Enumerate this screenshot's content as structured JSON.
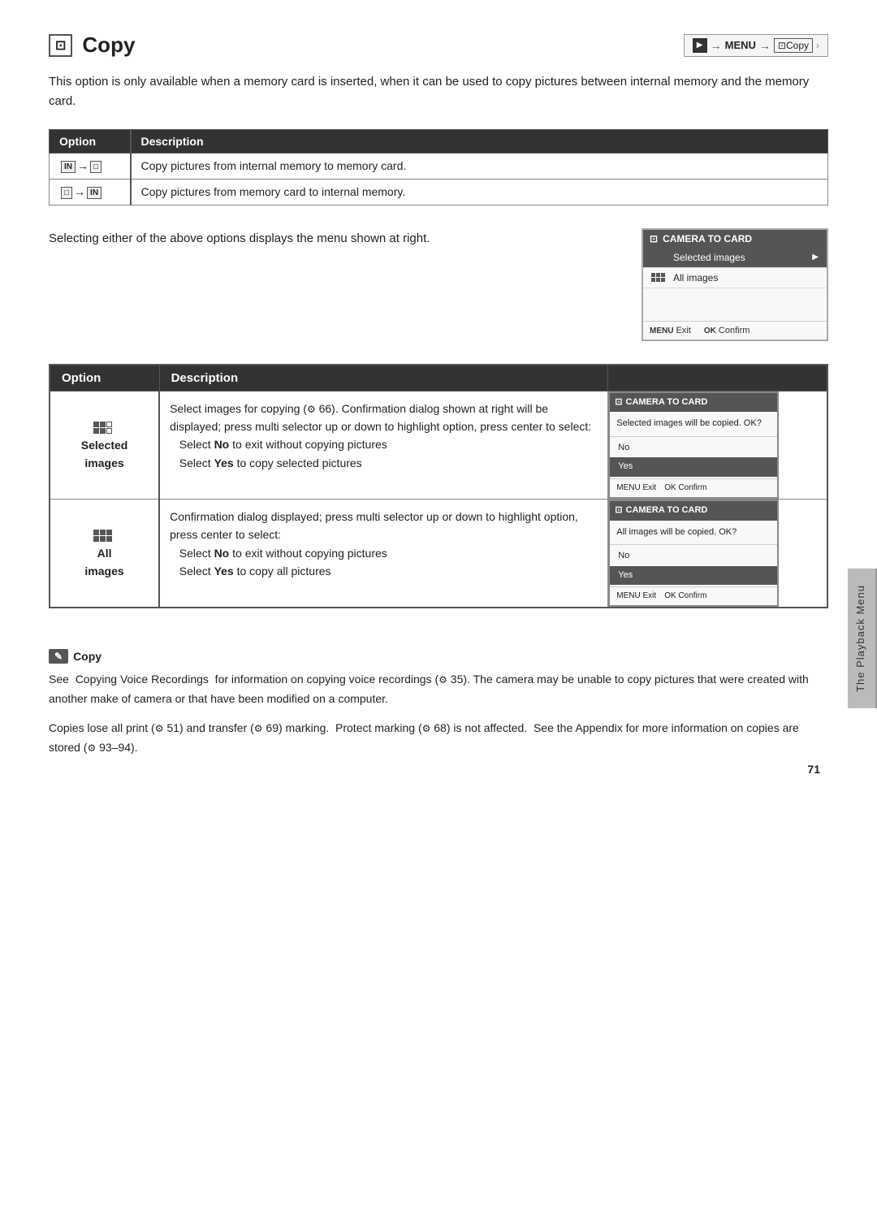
{
  "page": {
    "number": "71"
  },
  "sidebar": {
    "label": "The Playback Menu"
  },
  "header": {
    "title": "Copy",
    "breadcrumb": {
      "play": "▶",
      "menu": "MENU",
      "copy": "Copy",
      "chevron": "›"
    }
  },
  "intro": {
    "text": "This option is only available when a memory card is inserted, when it can be used to copy pictures between internal memory and the memory card."
  },
  "top_table": {
    "headers": [
      "Option",
      "Description"
    ],
    "rows": [
      {
        "option_icon": "IN→□",
        "description": "Copy pictures from internal memory to memory card."
      },
      {
        "option_icon": "□→IN",
        "description": "Copy pictures from memory card to internal memory."
      }
    ]
  },
  "middle": {
    "text": "Selecting either of the above options displays the menu shown at right.",
    "camera_menu": {
      "header": "CAMERA TO CARD",
      "items": [
        {
          "label": "Selected images",
          "selected": true,
          "has_arrow": true
        },
        {
          "label": "All images",
          "selected": false,
          "has_arrow": false
        }
      ],
      "footer_exit": "MENU Exit",
      "footer_confirm": "OK Confirm"
    }
  },
  "big_table": {
    "headers": [
      "Option",
      "Description"
    ],
    "rows": [
      {
        "option_label": "Selected images",
        "description_parts": [
          "Select images for copying (  66).  Confirmation dialog shown at right will be displayed; press multi selector up or down to highlight option, press center to select:",
          "Select No to exit without copying pictures",
          "Select Yes to copy selected pictures"
        ],
        "confirm_header": "CAMERA TO CARD",
        "confirm_body": "Selected images will be copied. OK?",
        "confirm_options": [
          "No",
          "Yes"
        ],
        "confirm_selected": "Yes",
        "confirm_footer_exit": "MENU Exit",
        "confirm_footer_confirm": "OK Confirm"
      },
      {
        "option_label": "All images",
        "description_parts": [
          "Confirmation dialog displayed; press multi selector up or down to highlight option, press center to select:",
          "Select No to exit without copying pictures",
          "Select Yes to copy all pictures"
        ],
        "confirm_header": "CAMERA TO CARD",
        "confirm_body": "All images will be copied. OK?",
        "confirm_options": [
          "No",
          "Yes"
        ],
        "confirm_selected": "Yes",
        "confirm_footer_exit": "MENU Exit",
        "confirm_footer_confirm": "OK Confirm"
      }
    ]
  },
  "note": {
    "icon_label": "Copy",
    "paragraphs": [
      "See  Copying Voice Recordings  for information on copying voice recordings (  35). The camera may be unable to copy pictures that were created with another make of camera or that have been modified on a computer.",
      "Copies lose all print (  51) and transfer (  69) marking.  Protect marking (  68) is not affected.  See the Appendix for more information on copies are stored (  93–94)."
    ]
  }
}
